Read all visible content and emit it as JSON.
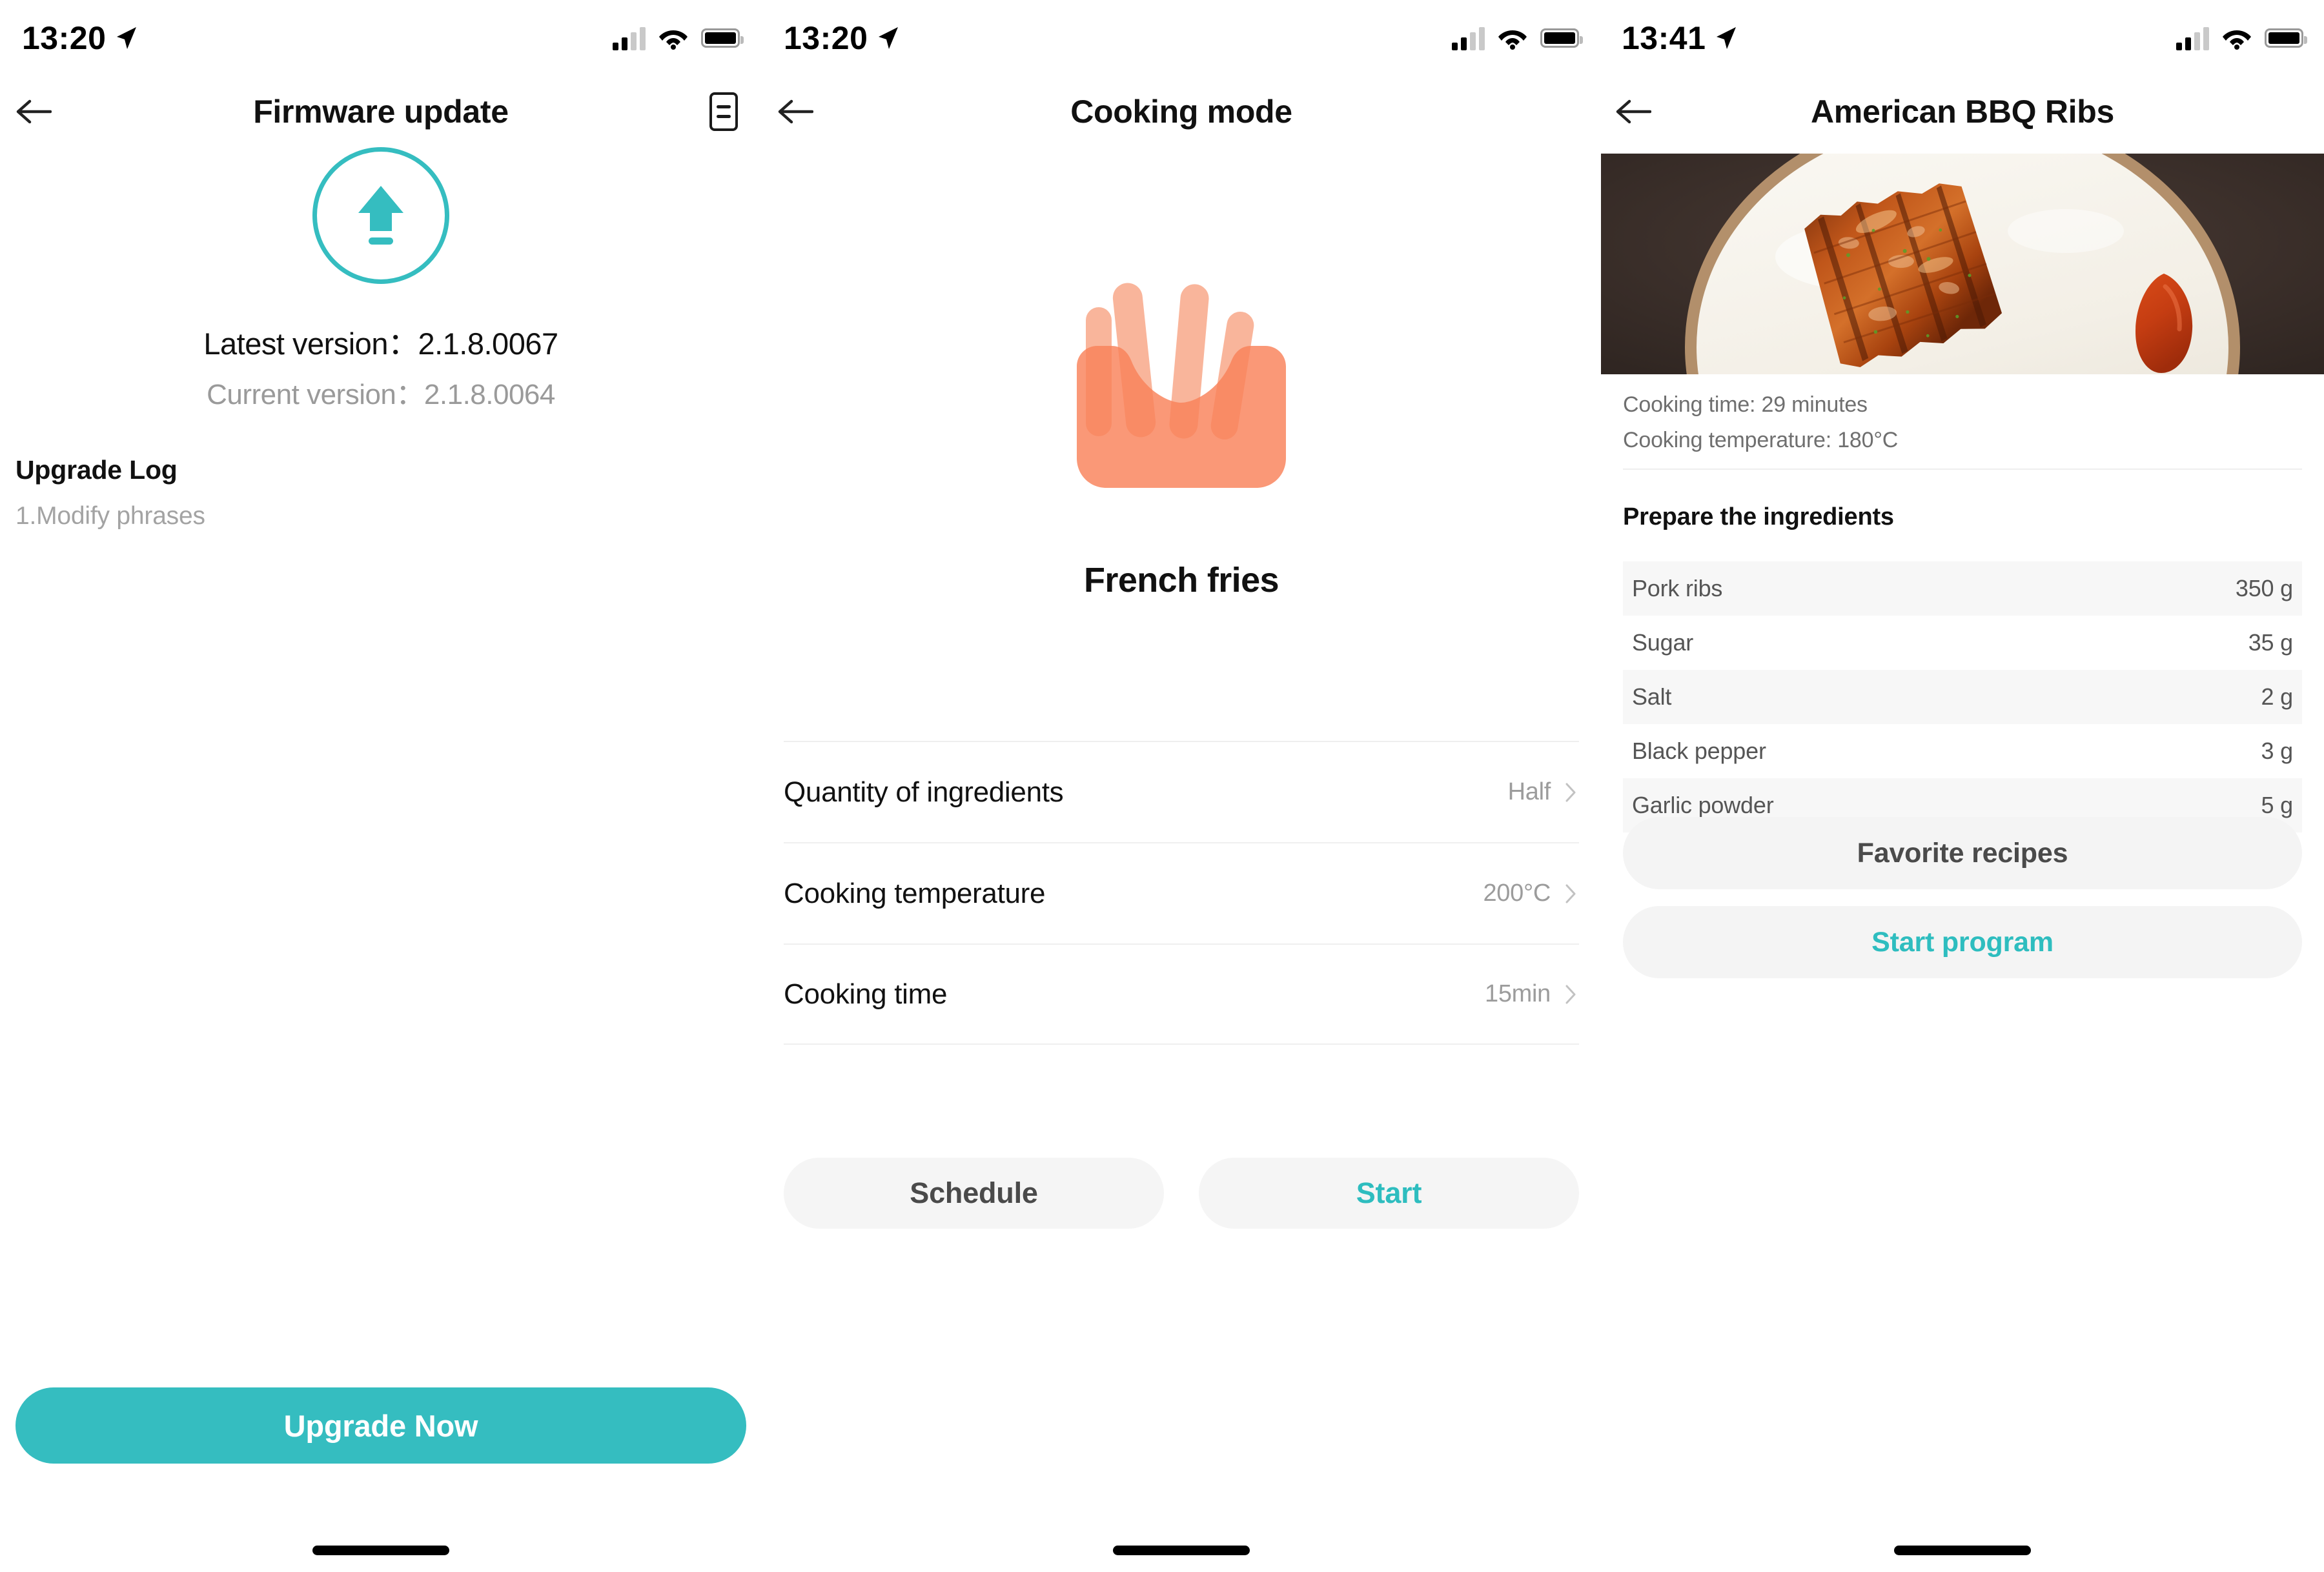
{
  "panels": [
    {
      "statusbar": {
        "time": "13:20",
        "location_icon": "location-arrow-icon",
        "signal_icon": "cellular-signal-icon",
        "wifi_icon": "wifi-icon",
        "battery_icon": "battery-icon"
      },
      "nav": {
        "back_icon": "back-arrow-icon",
        "title": "Firmware update",
        "action_icon": "log-document-icon"
      },
      "upgrade_icon": "upload-arrow-icon",
      "latest_label": "Latest version：",
      "latest_value": "2.1.8.0067",
      "current_label": "Current version：",
      "current_value": "2.1.8.0064",
      "log_title": "Upgrade Log",
      "log_items": [
        "1.Modify phrases"
      ],
      "upgrade_button": "Upgrade Now",
      "accent_color": "#35BDC0"
    },
    {
      "statusbar": {
        "time": "13:20",
        "location_icon": "location-arrow-icon",
        "signal_icon": "cellular-signal-icon",
        "wifi_icon": "wifi-icon",
        "battery_icon": "battery-icon"
      },
      "nav": {
        "back_icon": "back-arrow-icon",
        "title": "Cooking mode"
      },
      "dish_icon": "french-fries-icon",
      "dish_name": "French fries",
      "settings": [
        {
          "label": "Quantity of ingredients",
          "value": "Half",
          "chevron": "chevron-right-icon"
        },
        {
          "label": "Cooking temperature",
          "value": "200°C",
          "chevron": "chevron-right-icon"
        },
        {
          "label": "Cooking time",
          "value": "15min",
          "chevron": "chevron-right-icon"
        }
      ],
      "schedule_button": "Schedule",
      "start_button": "Start",
      "accent_color": "#2EBDBF"
    },
    {
      "statusbar": {
        "time": "13:41",
        "location_icon": "location-arrow-icon",
        "signal_icon": "cellular-signal-icon",
        "wifi_icon": "wifi-icon",
        "battery_icon": "battery-icon"
      },
      "nav": {
        "back_icon": "back-arrow-icon",
        "title": "American BBQ Ribs"
      },
      "photo_alt": "bbq-ribs-photo",
      "cooking_time": "Cooking time: 29 minutes",
      "cooking_temperature": "Cooking temperature: 180°C",
      "ingredients_title": "Prepare the ingredients",
      "ingredients": [
        {
          "name": "Pork ribs",
          "amount": "350 g"
        },
        {
          "name": "Sugar",
          "amount": "35 g"
        },
        {
          "name": "Salt",
          "amount": "2 g"
        },
        {
          "name": "Black pepper",
          "amount": "3 g"
        },
        {
          "name": "Garlic powder",
          "amount": "5 g"
        }
      ],
      "favorite_button": "Favorite recipes",
      "start_program_button": "Start program",
      "accent_color": "#2EBDBF"
    }
  ]
}
